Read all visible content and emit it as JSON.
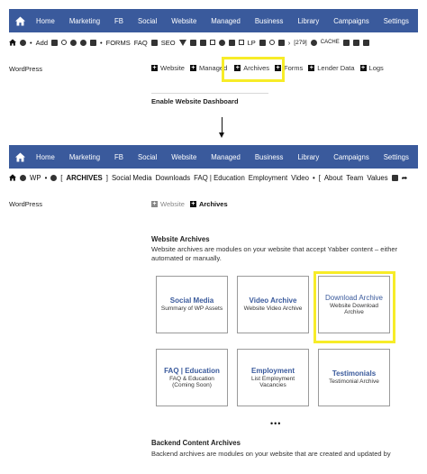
{
  "top": {
    "nav": [
      "Home",
      "Marketing",
      "FB",
      "Social",
      "Website",
      "Managed",
      "Business",
      "Library",
      "Campaigns",
      "Settings"
    ],
    "toolbar": [
      "Add",
      "FORMS",
      "FAQ",
      "SEO",
      "LP",
      "[279]",
      "CACHE"
    ],
    "side_label": "WordPress",
    "tabs": [
      "Website",
      "Managed",
      "Archives",
      "Forms",
      "Lender Data",
      "Logs"
    ],
    "cut_heading": "Enable Website Dashboard"
  },
  "bottom": {
    "nav": [
      "Home",
      "Marketing",
      "FB",
      "Social",
      "Website",
      "Managed",
      "Business",
      "Library",
      "Campaigns",
      "Settings"
    ],
    "breadcrumb": {
      "wp": "WP",
      "open_bracket": "[",
      "current": "ARCHIVES",
      "close_bracket": "]",
      "links": [
        "Social Media",
        "Downloads",
        "FAQ | Education",
        "Employment",
        "Video"
      ],
      "open_bracket2": "[",
      "links2": [
        "About",
        "Team",
        "Values"
      ]
    },
    "side_label": "WordPress",
    "tabs": [
      "Website",
      "Archives"
    ],
    "section_title": "Website Archives",
    "section_desc": "Website archives are modules on your website that accept Yabber content – either automated or manually.",
    "cards": [
      {
        "title": "Social Media",
        "sub": "Summary of WP Assets"
      },
      {
        "title": "Video Archive",
        "sub": "Website Video Archive"
      },
      {
        "title": "Download Archive",
        "sub": "Website Download Archive"
      },
      {
        "title": "FAQ | Education",
        "sub": "FAQ & Education (Coming Soon)"
      },
      {
        "title": "Employment",
        "sub": "List Employment Vacancies"
      },
      {
        "title": "Testimonials",
        "sub": "Testimonial Archive"
      }
    ],
    "more": "•••",
    "backend_title": "Backend Content Archives",
    "backend_desc": "Backend archives are modules on your website that are created and updated by"
  },
  "icons": [
    "home-icon",
    "wordpress-icon",
    "plus-icon",
    "share-icon",
    "shuffle-icon",
    "chevron-right-icon"
  ],
  "colors": {
    "nav": "#3a5a9c",
    "highlight": "#f7ec28",
    "link": "#3a5a9c"
  }
}
